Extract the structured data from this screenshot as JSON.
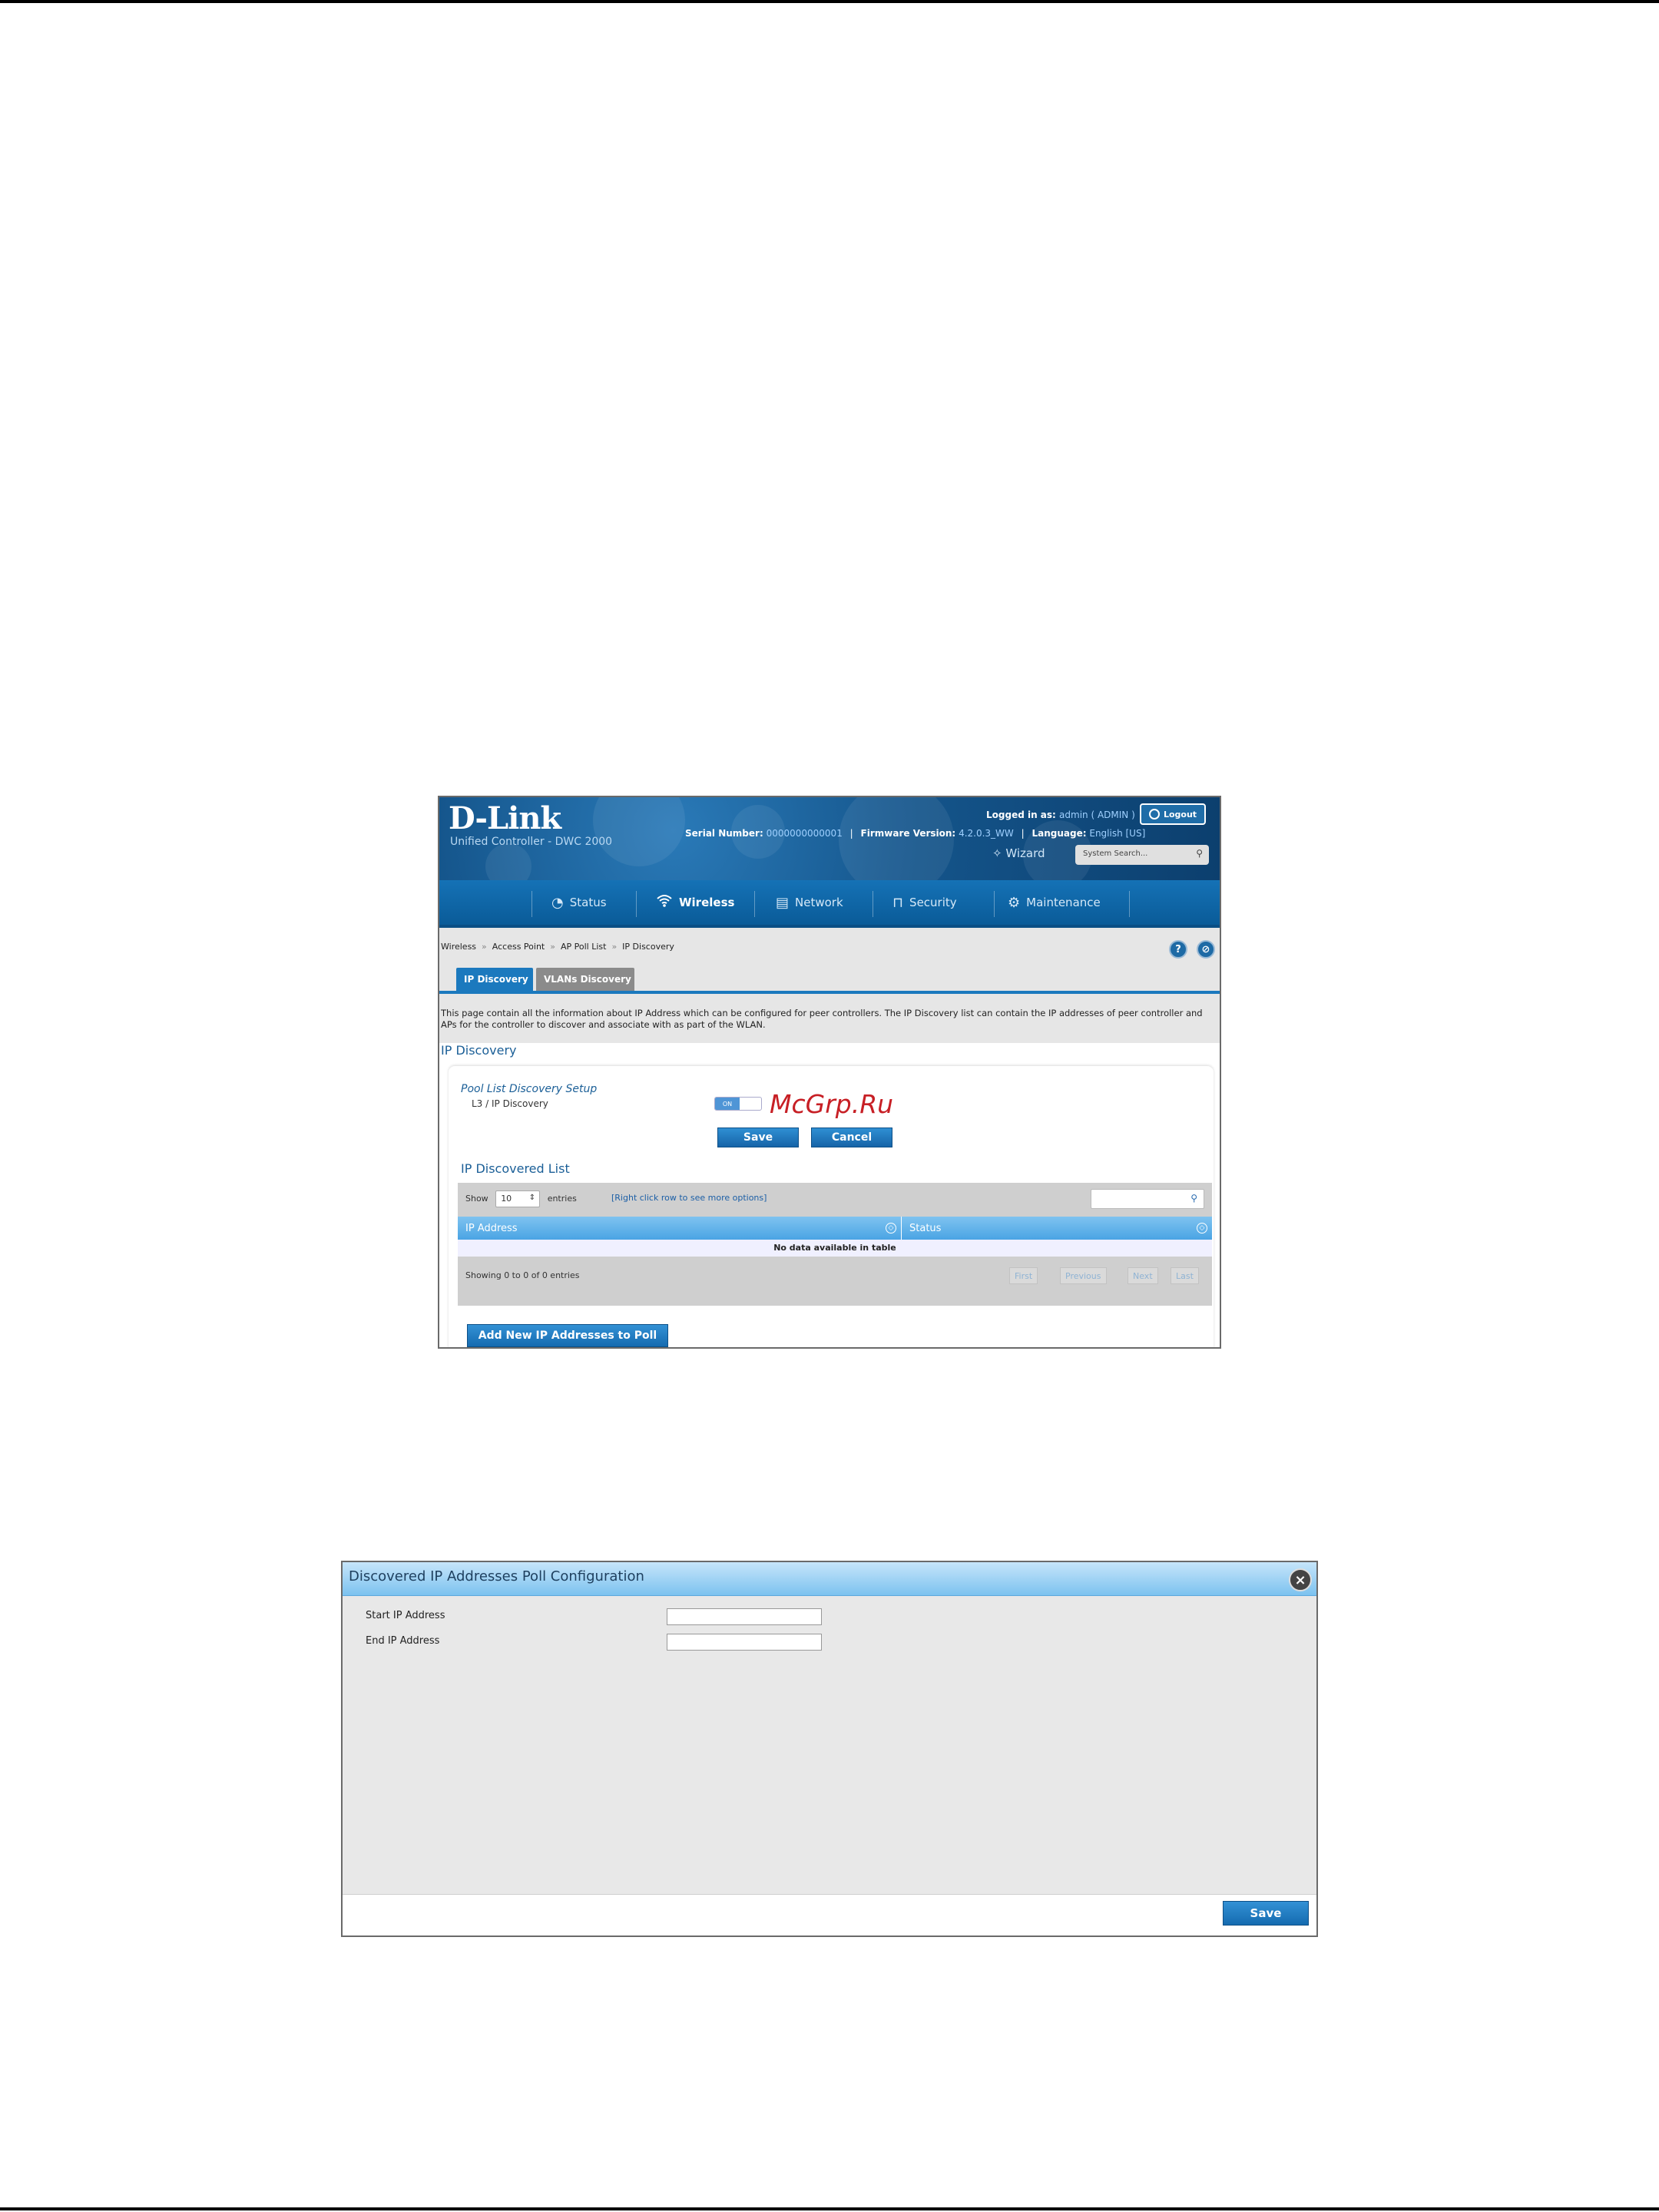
{
  "ip_discovery_page": {
    "brand": {
      "logo": "D-Link",
      "product": "Unified Controller - DWC 2000"
    },
    "header": {
      "serial_label": "Serial Number:",
      "serial_value": "0000000000001",
      "firmware_label": "Firmware Version:",
      "firmware_value": "4.2.0.3_WW",
      "language_label": "Language:",
      "language_value": "English [US]",
      "logged_in_label": "Logged in as:",
      "logged_in_value": "admin ( ADMIN )",
      "logout_label": "Logout",
      "wizard_label": "Wizard",
      "search_placeholder": "System Search..."
    },
    "nav": [
      {
        "label": "Status",
        "icon": "gauge-icon",
        "active": false
      },
      {
        "label": "Wireless",
        "icon": "wifi-icon",
        "active": true
      },
      {
        "label": "Network",
        "icon": "network-icon",
        "active": false
      },
      {
        "label": "Security",
        "icon": "lock-icon",
        "active": false
      },
      {
        "label": "Maintenance",
        "icon": "gears-icon",
        "active": false
      }
    ],
    "breadcrumb": [
      "Wireless",
      "Access Point",
      "AP Poll List",
      "IP Discovery"
    ],
    "tabs": [
      {
        "label": "IP Discovery",
        "active": true
      },
      {
        "label": "VLANs Discovery",
        "active": false
      }
    ],
    "description": "This page contain all the information about IP Address which can be configured for peer controllers. The IP Discovery list can contain the IP addresses of peer controller and APs for the controller to discover and associate with as part of the WLAN.",
    "section_title": "IP Discovery",
    "setup": {
      "title": "Pool List Discovery Setup",
      "field_label": "L3 / IP Discovery",
      "toggle_state": "ON",
      "save_label": "Save",
      "cancel_label": "Cancel"
    },
    "watermark": "McGrp.Ru",
    "list": {
      "title": "IP Discovered List",
      "show_label": "Show",
      "show_value": "10",
      "entries_label": "entries",
      "hint": "[Right click row to see more options]",
      "columns": [
        "IP Address",
        "Status"
      ],
      "empty_message": "No data available in table",
      "showing": "Showing 0 to 0 of 0 entries",
      "pager": [
        "First",
        "Previous",
        "Next",
        "Last"
      ]
    },
    "add_button": "Add New IP Addresses to Poll",
    "colors": {
      "nav_blue": "#1572b6",
      "header_dark": "#0c3f6e",
      "accent": "#1b79be",
      "watermark_red": "#c71f25"
    }
  },
  "poll_dialog": {
    "title": "Discovered IP Addresses Poll Configuration",
    "close_icon": "close-icon",
    "fields": [
      {
        "label": "Start IP Address",
        "value": ""
      },
      {
        "label": "End IP Address",
        "value": ""
      }
    ],
    "save_label": "Save"
  }
}
